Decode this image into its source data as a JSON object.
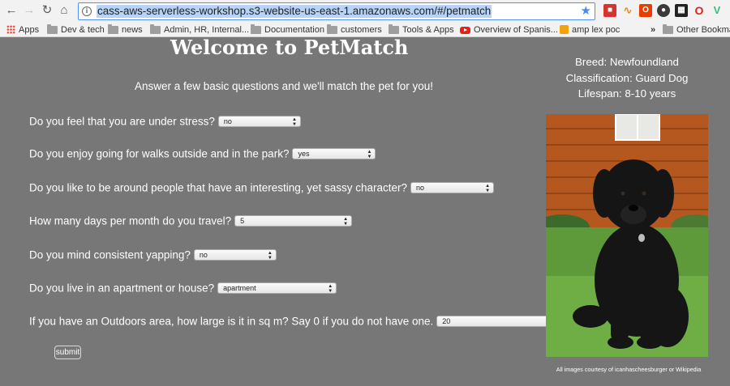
{
  "browser": {
    "url": "cass-aws-serverless-workshop.s3-website-us-east-1.amazonaws.com/#/petmatch",
    "bookmarks": [
      {
        "label": "Apps",
        "icon": "apps-grid-icon"
      },
      {
        "label": "Dev & tech",
        "icon": "folder-icon"
      },
      {
        "label": "news",
        "icon": "folder-icon"
      },
      {
        "label": "Admin, HR, Internal...",
        "icon": "folder-icon"
      },
      {
        "label": "Documentation",
        "icon": "folder-icon"
      },
      {
        "label": "customers",
        "icon": "folder-icon"
      },
      {
        "label": "Tools & Apps",
        "icon": "folder-icon"
      },
      {
        "label": "Overview of Spanis...",
        "icon": "youtube-icon"
      },
      {
        "label": "amp lex poc",
        "icon": "amp-icon"
      }
    ],
    "overflow_label": "»",
    "other_bookmarks": "Other Bookmar",
    "accent": "#4d90fe"
  },
  "page": {
    "title": "Welcome to PetMatch",
    "subtitle": "Answer a few basic questions and we'll match the pet for you!",
    "questions": [
      {
        "label": "Do you feel that you are under stress?",
        "value": "no"
      },
      {
        "label": "Do you enjoy going for walks outside and in the park?",
        "value": "yes"
      },
      {
        "label": "Do you like to be around people that have an interesting, yet sassy character?",
        "value": "no"
      },
      {
        "label": "How many days per month do you travel?",
        "value": "5"
      },
      {
        "label": "Do you mind consistent yapping?",
        "value": "no"
      },
      {
        "label": "Do you live in an apartment or house?",
        "value": "apartment"
      },
      {
        "label": "If you have an Outdoors area, how large is it in sq m? Say 0 if you do not have one.",
        "value": "20"
      }
    ],
    "submit_label": "submit",
    "pet": {
      "breed": "Breed: Newfoundland",
      "classification": "Classification: Guard Dog",
      "lifespan": "Lifespan: 8-10 years"
    },
    "credit": "All images courtesy of icanhascheesburger or Wikipedia",
    "background": "#777777"
  }
}
